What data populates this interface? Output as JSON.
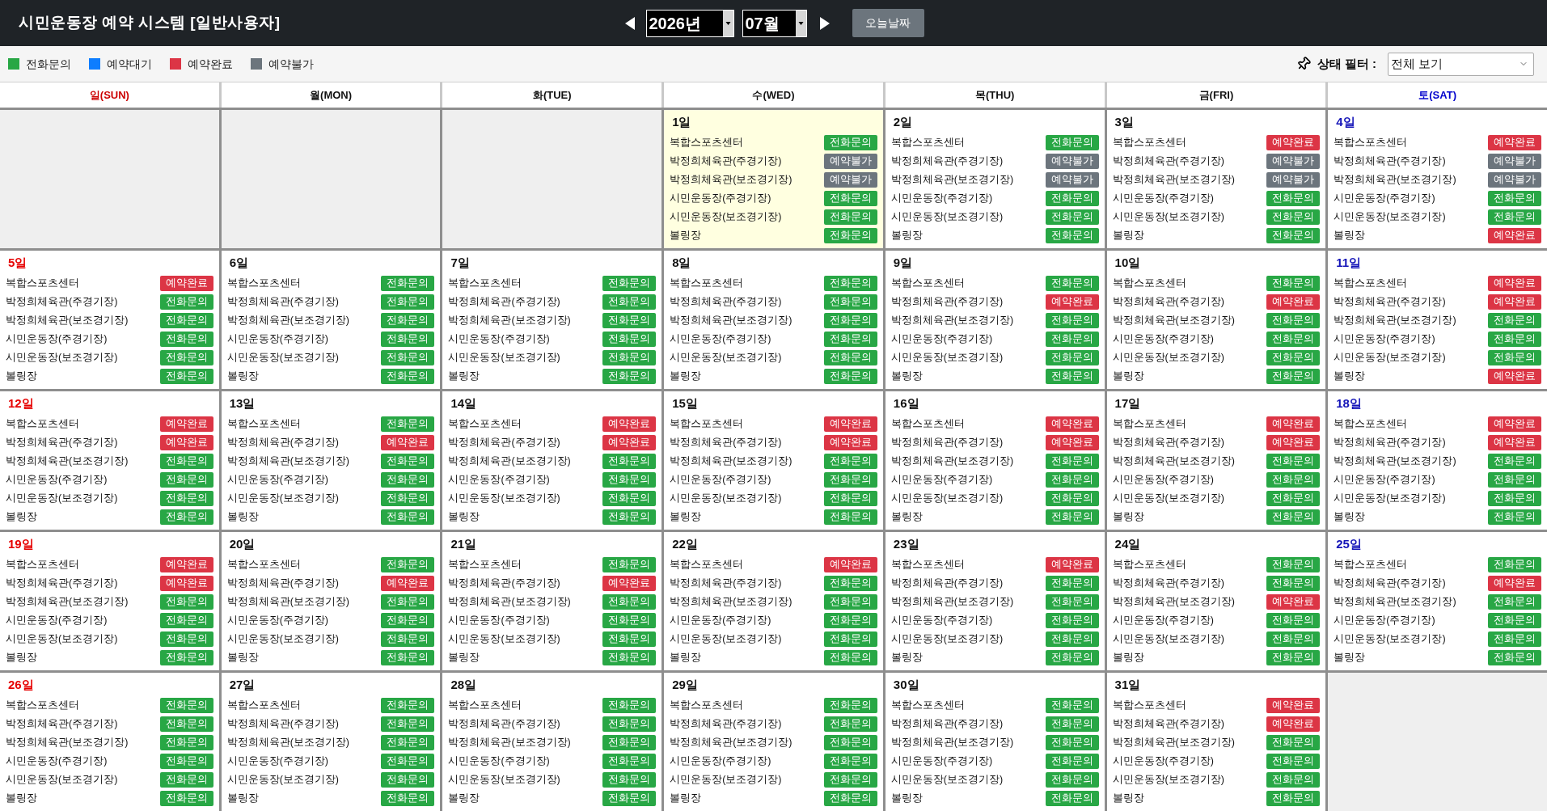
{
  "header": {
    "title": "시민운동장 예약 시스템 [일반사용자]",
    "year": "2026년",
    "month": "07월",
    "today_button": "오늘날짜"
  },
  "legend": [
    {
      "label": "전화문의",
      "kind": "phone",
      "color": "#28a745"
    },
    {
      "label": "예약대기",
      "kind": "waiting",
      "color": "#0d7dff"
    },
    {
      "label": "예약완료",
      "kind": "booked",
      "color": "#dc3545"
    },
    {
      "label": "예약불가",
      "kind": "unavailable",
      "color": "#6c757d"
    }
  ],
  "filter": {
    "label": "상태 필터 :",
    "value": "전체 보기"
  },
  "calendar": {
    "weekdays": [
      {
        "label": "일(SUN)",
        "kind": "sunday"
      },
      {
        "label": "월(MON)",
        "kind": "weekday"
      },
      {
        "label": "화(TUE)",
        "kind": "weekday"
      },
      {
        "label": "수(WED)",
        "kind": "weekday"
      },
      {
        "label": "목(THU)",
        "kind": "weekday"
      },
      {
        "label": "금(FRI)",
        "kind": "weekday"
      },
      {
        "label": "토(SAT)",
        "kind": "saturday"
      }
    ],
    "weeks": [
      {
        "cells": [
          {
            "kind": "blank"
          },
          {
            "kind": "blank"
          },
          {
            "kind": "blank"
          },
          {
            "kind": "day",
            "date": "1일",
            "today": true,
            "slots": [
              {
                "facility": "복합스포츠센터",
                "status": "전화문의",
                "kind": "phone"
              },
              {
                "facility": "박정희체육관(주경기장)",
                "status": "예약불가",
                "kind": "unavailable"
              },
              {
                "facility": "박정희체육관(보조경기장)",
                "status": "예약불가",
                "kind": "unavailable"
              },
              {
                "facility": "시민운동장(주경기장)",
                "status": "전화문의",
                "kind": "phone"
              },
              {
                "facility": "시민운동장(보조경기장)",
                "status": "전화문의",
                "kind": "phone"
              },
              {
                "facility": "볼링장",
                "status": "전화문의",
                "kind": "phone"
              }
            ]
          },
          {
            "kind": "day",
            "date": "2일",
            "today": false,
            "slots": [
              {
                "facility": "복합스포츠센터",
                "status": "전화문의",
                "kind": "phone"
              },
              {
                "facility": "박정희체육관(주경기장)",
                "status": "예약불가",
                "kind": "unavailable"
              },
              {
                "facility": "박정희체육관(보조경기장)",
                "status": "예약불가",
                "kind": "unavailable"
              },
              {
                "facility": "시민운동장(주경기장)",
                "status": "전화문의",
                "kind": "phone"
              },
              {
                "facility": "시민운동장(보조경기장)",
                "status": "전화문의",
                "kind": "phone"
              },
              {
                "facility": "볼링장",
                "status": "전화문의",
                "kind": "phone"
              }
            ]
          },
          {
            "kind": "day",
            "date": "3일",
            "today": false,
            "slots": [
              {
                "facility": "복합스포츠센터",
                "status": "예약완료",
                "kind": "booked"
              },
              {
                "facility": "박정희체육관(주경기장)",
                "status": "예약불가",
                "kind": "unavailable"
              },
              {
                "facility": "박정희체육관(보조경기장)",
                "status": "예약불가",
                "kind": "unavailable"
              },
              {
                "facility": "시민운동장(주경기장)",
                "status": "전화문의",
                "kind": "phone"
              },
              {
                "facility": "시민운동장(보조경기장)",
                "status": "전화문의",
                "kind": "phone"
              },
              {
                "facility": "볼링장",
                "status": "전화문의",
                "kind": "phone"
              }
            ]
          },
          {
            "kind": "day",
            "date": "4일",
            "today": false,
            "slots": [
              {
                "facility": "복합스포츠센터",
                "status": "예약완료",
                "kind": "booked"
              },
              {
                "facility": "박정희체육관(주경기장)",
                "status": "예약불가",
                "kind": "unavailable"
              },
              {
                "facility": "박정희체육관(보조경기장)",
                "status": "예약불가",
                "kind": "unavailable"
              },
              {
                "facility": "시민운동장(주경기장)",
                "status": "전화문의",
                "kind": "phone"
              },
              {
                "facility": "시민운동장(보조경기장)",
                "status": "전화문의",
                "kind": "phone"
              },
              {
                "facility": "볼링장",
                "status": "예약완료",
                "kind": "booked"
              }
            ]
          }
        ]
      },
      {
        "cells": [
          {
            "kind": "day",
            "date": "5일",
            "today": false,
            "slots": [
              {
                "facility": "복합스포츠센터",
                "status": "예약완료",
                "kind": "booked"
              },
              {
                "facility": "박정희체육관(주경기장)",
                "status": "전화문의",
                "kind": "phone"
              },
              {
                "facility": "박정희체육관(보조경기장)",
                "status": "전화문의",
                "kind": "phone"
              },
              {
                "facility": "시민운동장(주경기장)",
                "status": "전화문의",
                "kind": "phone"
              },
              {
                "facility": "시민운동장(보조경기장)",
                "status": "전화문의",
                "kind": "phone"
              },
              {
                "facility": "볼링장",
                "status": "전화문의",
                "kind": "phone"
              }
            ]
          },
          {
            "kind": "day",
            "date": "6일",
            "today": false,
            "slots": [
              {
                "facility": "복합스포츠센터",
                "status": "전화문의",
                "kind": "phone"
              },
              {
                "facility": "박정희체육관(주경기장)",
                "status": "전화문의",
                "kind": "phone"
              },
              {
                "facility": "박정희체육관(보조경기장)",
                "status": "전화문의",
                "kind": "phone"
              },
              {
                "facility": "시민운동장(주경기장)",
                "status": "전화문의",
                "kind": "phone"
              },
              {
                "facility": "시민운동장(보조경기장)",
                "status": "전화문의",
                "kind": "phone"
              },
              {
                "facility": "볼링장",
                "status": "전화문의",
                "kind": "phone"
              }
            ]
          },
          {
            "kind": "day",
            "date": "7일",
            "today": false,
            "slots": [
              {
                "facility": "복합스포츠센터",
                "status": "전화문의",
                "kind": "phone"
              },
              {
                "facility": "박정희체육관(주경기장)",
                "status": "전화문의",
                "kind": "phone"
              },
              {
                "facility": "박정희체육관(보조경기장)",
                "status": "전화문의",
                "kind": "phone"
              },
              {
                "facility": "시민운동장(주경기장)",
                "status": "전화문의",
                "kind": "phone"
              },
              {
                "facility": "시민운동장(보조경기장)",
                "status": "전화문의",
                "kind": "phone"
              },
              {
                "facility": "볼링장",
                "status": "전화문의",
                "kind": "phone"
              }
            ]
          },
          {
            "kind": "day",
            "date": "8일",
            "today": false,
            "slots": [
              {
                "facility": "복합스포츠센터",
                "status": "전화문의",
                "kind": "phone"
              },
              {
                "facility": "박정희체육관(주경기장)",
                "status": "전화문의",
                "kind": "phone"
              },
              {
                "facility": "박정희체육관(보조경기장)",
                "status": "전화문의",
                "kind": "phone"
              },
              {
                "facility": "시민운동장(주경기장)",
                "status": "전화문의",
                "kind": "phone"
              },
              {
                "facility": "시민운동장(보조경기장)",
                "status": "전화문의",
                "kind": "phone"
              },
              {
                "facility": "볼링장",
                "status": "전화문의",
                "kind": "phone"
              }
            ]
          },
          {
            "kind": "day",
            "date": "9일",
            "today": false,
            "slots": [
              {
                "facility": "복합스포츠센터",
                "status": "전화문의",
                "kind": "phone"
              },
              {
                "facility": "박정희체육관(주경기장)",
                "status": "예약완료",
                "kind": "booked"
              },
              {
                "facility": "박정희체육관(보조경기장)",
                "status": "전화문의",
                "kind": "phone"
              },
              {
                "facility": "시민운동장(주경기장)",
                "status": "전화문의",
                "kind": "phone"
              },
              {
                "facility": "시민운동장(보조경기장)",
                "status": "전화문의",
                "kind": "phone"
              },
              {
                "facility": "볼링장",
                "status": "전화문의",
                "kind": "phone"
              }
            ]
          },
          {
            "kind": "day",
            "date": "10일",
            "today": false,
            "slots": [
              {
                "facility": "복합스포츠센터",
                "status": "전화문의",
                "kind": "phone"
              },
              {
                "facility": "박정희체육관(주경기장)",
                "status": "예약완료",
                "kind": "booked"
              },
              {
                "facility": "박정희체육관(보조경기장)",
                "status": "전화문의",
                "kind": "phone"
              },
              {
                "facility": "시민운동장(주경기장)",
                "status": "전화문의",
                "kind": "phone"
              },
              {
                "facility": "시민운동장(보조경기장)",
                "status": "전화문의",
                "kind": "phone"
              },
              {
                "facility": "볼링장",
                "status": "전화문의",
                "kind": "phone"
              }
            ]
          },
          {
            "kind": "day",
            "date": "11일",
            "today": false,
            "slots": [
              {
                "facility": "복합스포츠센터",
                "status": "예약완료",
                "kind": "booked"
              },
              {
                "facility": "박정희체육관(주경기장)",
                "status": "예약완료",
                "kind": "booked"
              },
              {
                "facility": "박정희체육관(보조경기장)",
                "status": "전화문의",
                "kind": "phone"
              },
              {
                "facility": "시민운동장(주경기장)",
                "status": "전화문의",
                "kind": "phone"
              },
              {
                "facility": "시민운동장(보조경기장)",
                "status": "전화문의",
                "kind": "phone"
              },
              {
                "facility": "볼링장",
                "status": "예약완료",
                "kind": "booked"
              }
            ]
          }
        ]
      },
      {
        "cells": [
          {
            "kind": "day",
            "date": "12일",
            "today": false,
            "slots": [
              {
                "facility": "복합스포츠센터",
                "status": "예약완료",
                "kind": "booked"
              },
              {
                "facility": "박정희체육관(주경기장)",
                "status": "예약완료",
                "kind": "booked"
              },
              {
                "facility": "박정희체육관(보조경기장)",
                "status": "전화문의",
                "kind": "phone"
              },
              {
                "facility": "시민운동장(주경기장)",
                "status": "전화문의",
                "kind": "phone"
              },
              {
                "facility": "시민운동장(보조경기장)",
                "status": "전화문의",
                "kind": "phone"
              },
              {
                "facility": "볼링장",
                "status": "전화문의",
                "kind": "phone"
              }
            ]
          },
          {
            "kind": "day",
            "date": "13일",
            "today": false,
            "slots": [
              {
                "facility": "복합스포츠센터",
                "status": "전화문의",
                "kind": "phone"
              },
              {
                "facility": "박정희체육관(주경기장)",
                "status": "예약완료",
                "kind": "booked"
              },
              {
                "facility": "박정희체육관(보조경기장)",
                "status": "전화문의",
                "kind": "phone"
              },
              {
                "facility": "시민운동장(주경기장)",
                "status": "전화문의",
                "kind": "phone"
              },
              {
                "facility": "시민운동장(보조경기장)",
                "status": "전화문의",
                "kind": "phone"
              },
              {
                "facility": "볼링장",
                "status": "전화문의",
                "kind": "phone"
              }
            ]
          },
          {
            "kind": "day",
            "date": "14일",
            "today": false,
            "slots": [
              {
                "facility": "복합스포츠센터",
                "status": "예약완료",
                "kind": "booked"
              },
              {
                "facility": "박정희체육관(주경기장)",
                "status": "예약완료",
                "kind": "booked"
              },
              {
                "facility": "박정희체육관(보조경기장)",
                "status": "전화문의",
                "kind": "phone"
              },
              {
                "facility": "시민운동장(주경기장)",
                "status": "전화문의",
                "kind": "phone"
              },
              {
                "facility": "시민운동장(보조경기장)",
                "status": "전화문의",
                "kind": "phone"
              },
              {
                "facility": "볼링장",
                "status": "전화문의",
                "kind": "phone"
              }
            ]
          },
          {
            "kind": "day",
            "date": "15일",
            "today": false,
            "slots": [
              {
                "facility": "복합스포츠센터",
                "status": "예약완료",
                "kind": "booked"
              },
              {
                "facility": "박정희체육관(주경기장)",
                "status": "예약완료",
                "kind": "booked"
              },
              {
                "facility": "박정희체육관(보조경기장)",
                "status": "전화문의",
                "kind": "phone"
              },
              {
                "facility": "시민운동장(주경기장)",
                "status": "전화문의",
                "kind": "phone"
              },
              {
                "facility": "시민운동장(보조경기장)",
                "status": "전화문의",
                "kind": "phone"
              },
              {
                "facility": "볼링장",
                "status": "전화문의",
                "kind": "phone"
              }
            ]
          },
          {
            "kind": "day",
            "date": "16일",
            "today": false,
            "slots": [
              {
                "facility": "복합스포츠센터",
                "status": "예약완료",
                "kind": "booked"
              },
              {
                "facility": "박정희체육관(주경기장)",
                "status": "예약완료",
                "kind": "booked"
              },
              {
                "facility": "박정희체육관(보조경기장)",
                "status": "전화문의",
                "kind": "phone"
              },
              {
                "facility": "시민운동장(주경기장)",
                "status": "전화문의",
                "kind": "phone"
              },
              {
                "facility": "시민운동장(보조경기장)",
                "status": "전화문의",
                "kind": "phone"
              },
              {
                "facility": "볼링장",
                "status": "전화문의",
                "kind": "phone"
              }
            ]
          },
          {
            "kind": "day",
            "date": "17일",
            "today": false,
            "slots": [
              {
                "facility": "복합스포츠센터",
                "status": "예약완료",
                "kind": "booked"
              },
              {
                "facility": "박정희체육관(주경기장)",
                "status": "예약완료",
                "kind": "booked"
              },
              {
                "facility": "박정희체육관(보조경기장)",
                "status": "전화문의",
                "kind": "phone"
              },
              {
                "facility": "시민운동장(주경기장)",
                "status": "전화문의",
                "kind": "phone"
              },
              {
                "facility": "시민운동장(보조경기장)",
                "status": "전화문의",
                "kind": "phone"
              },
              {
                "facility": "볼링장",
                "status": "전화문의",
                "kind": "phone"
              }
            ]
          },
          {
            "kind": "day",
            "date": "18일",
            "today": false,
            "slots": [
              {
                "facility": "복합스포츠센터",
                "status": "예약완료",
                "kind": "booked"
              },
              {
                "facility": "박정희체육관(주경기장)",
                "status": "예약완료",
                "kind": "booked"
              },
              {
                "facility": "박정희체육관(보조경기장)",
                "status": "전화문의",
                "kind": "phone"
              },
              {
                "facility": "시민운동장(주경기장)",
                "status": "전화문의",
                "kind": "phone"
              },
              {
                "facility": "시민운동장(보조경기장)",
                "status": "전화문의",
                "kind": "phone"
              },
              {
                "facility": "볼링장",
                "status": "전화문의",
                "kind": "phone"
              }
            ]
          }
        ]
      },
      {
        "cells": [
          {
            "kind": "day",
            "date": "19일",
            "today": false,
            "slots": [
              {
                "facility": "복합스포츠센터",
                "status": "예약완료",
                "kind": "booked"
              },
              {
                "facility": "박정희체육관(주경기장)",
                "status": "예약완료",
                "kind": "booked"
              },
              {
                "facility": "박정희체육관(보조경기장)",
                "status": "전화문의",
                "kind": "phone"
              },
              {
                "facility": "시민운동장(주경기장)",
                "status": "전화문의",
                "kind": "phone"
              },
              {
                "facility": "시민운동장(보조경기장)",
                "status": "전화문의",
                "kind": "phone"
              },
              {
                "facility": "볼링장",
                "status": "전화문의",
                "kind": "phone"
              }
            ]
          },
          {
            "kind": "day",
            "date": "20일",
            "today": false,
            "slots": [
              {
                "facility": "복합스포츠센터",
                "status": "전화문의",
                "kind": "phone"
              },
              {
                "facility": "박정희체육관(주경기장)",
                "status": "예약완료",
                "kind": "booked"
              },
              {
                "facility": "박정희체육관(보조경기장)",
                "status": "전화문의",
                "kind": "phone"
              },
              {
                "facility": "시민운동장(주경기장)",
                "status": "전화문의",
                "kind": "phone"
              },
              {
                "facility": "시민운동장(보조경기장)",
                "status": "전화문의",
                "kind": "phone"
              },
              {
                "facility": "볼링장",
                "status": "전화문의",
                "kind": "phone"
              }
            ]
          },
          {
            "kind": "day",
            "date": "21일",
            "today": false,
            "slots": [
              {
                "facility": "복합스포츠센터",
                "status": "전화문의",
                "kind": "phone"
              },
              {
                "facility": "박정희체육관(주경기장)",
                "status": "예약완료",
                "kind": "booked"
              },
              {
                "facility": "박정희체육관(보조경기장)",
                "status": "전화문의",
                "kind": "phone"
              },
              {
                "facility": "시민운동장(주경기장)",
                "status": "전화문의",
                "kind": "phone"
              },
              {
                "facility": "시민운동장(보조경기장)",
                "status": "전화문의",
                "kind": "phone"
              },
              {
                "facility": "볼링장",
                "status": "전화문의",
                "kind": "phone"
              }
            ]
          },
          {
            "kind": "day",
            "date": "22일",
            "today": false,
            "slots": [
              {
                "facility": "복합스포츠센터",
                "status": "예약완료",
                "kind": "booked"
              },
              {
                "facility": "박정희체육관(주경기장)",
                "status": "전화문의",
                "kind": "phone"
              },
              {
                "facility": "박정희체육관(보조경기장)",
                "status": "전화문의",
                "kind": "phone"
              },
              {
                "facility": "시민운동장(주경기장)",
                "status": "전화문의",
                "kind": "phone"
              },
              {
                "facility": "시민운동장(보조경기장)",
                "status": "전화문의",
                "kind": "phone"
              },
              {
                "facility": "볼링장",
                "status": "전화문의",
                "kind": "phone"
              }
            ]
          },
          {
            "kind": "day",
            "date": "23일",
            "today": false,
            "slots": [
              {
                "facility": "복합스포츠센터",
                "status": "예약완료",
                "kind": "booked"
              },
              {
                "facility": "박정희체육관(주경기장)",
                "status": "전화문의",
                "kind": "phone"
              },
              {
                "facility": "박정희체육관(보조경기장)",
                "status": "전화문의",
                "kind": "phone"
              },
              {
                "facility": "시민운동장(주경기장)",
                "status": "전화문의",
                "kind": "phone"
              },
              {
                "facility": "시민운동장(보조경기장)",
                "status": "전화문의",
                "kind": "phone"
              },
              {
                "facility": "볼링장",
                "status": "전화문의",
                "kind": "phone"
              }
            ]
          },
          {
            "kind": "day",
            "date": "24일",
            "today": false,
            "slots": [
              {
                "facility": "복합스포츠센터",
                "status": "전화문의",
                "kind": "phone"
              },
              {
                "facility": "박정희체육관(주경기장)",
                "status": "전화문의",
                "kind": "phone"
              },
              {
                "facility": "박정희체육관(보조경기장)",
                "status": "예약완료",
                "kind": "booked"
              },
              {
                "facility": "시민운동장(주경기장)",
                "status": "전화문의",
                "kind": "phone"
              },
              {
                "facility": "시민운동장(보조경기장)",
                "status": "전화문의",
                "kind": "phone"
              },
              {
                "facility": "볼링장",
                "status": "전화문의",
                "kind": "phone"
              }
            ]
          },
          {
            "kind": "day",
            "date": "25일",
            "today": false,
            "slots": [
              {
                "facility": "복합스포츠센터",
                "status": "전화문의",
                "kind": "phone"
              },
              {
                "facility": "박정희체육관(주경기장)",
                "status": "예약완료",
                "kind": "booked"
              },
              {
                "facility": "박정희체육관(보조경기장)",
                "status": "전화문의",
                "kind": "phone"
              },
              {
                "facility": "시민운동장(주경기장)",
                "status": "전화문의",
                "kind": "phone"
              },
              {
                "facility": "시민운동장(보조경기장)",
                "status": "전화문의",
                "kind": "phone"
              },
              {
                "facility": "볼링장",
                "status": "전화문의",
                "kind": "phone"
              }
            ]
          }
        ]
      },
      {
        "cells": [
          {
            "kind": "day",
            "date": "26일",
            "today": false,
            "slots": [
              {
                "facility": "복합스포츠센터",
                "status": "전화문의",
                "kind": "phone"
              },
              {
                "facility": "박정희체육관(주경기장)",
                "status": "전화문의",
                "kind": "phone"
              },
              {
                "facility": "박정희체육관(보조경기장)",
                "status": "전화문의",
                "kind": "phone"
              },
              {
                "facility": "시민운동장(주경기장)",
                "status": "전화문의",
                "kind": "phone"
              },
              {
                "facility": "시민운동장(보조경기장)",
                "status": "전화문의",
                "kind": "phone"
              },
              {
                "facility": "볼링장",
                "status": "전화문의",
                "kind": "phone"
              }
            ]
          },
          {
            "kind": "day",
            "date": "27일",
            "today": false,
            "slots": [
              {
                "facility": "복합스포츠센터",
                "status": "전화문의",
                "kind": "phone"
              },
              {
                "facility": "박정희체육관(주경기장)",
                "status": "전화문의",
                "kind": "phone"
              },
              {
                "facility": "박정희체육관(보조경기장)",
                "status": "전화문의",
                "kind": "phone"
              },
              {
                "facility": "시민운동장(주경기장)",
                "status": "전화문의",
                "kind": "phone"
              },
              {
                "facility": "시민운동장(보조경기장)",
                "status": "전화문의",
                "kind": "phone"
              },
              {
                "facility": "볼링장",
                "status": "전화문의",
                "kind": "phone"
              }
            ]
          },
          {
            "kind": "day",
            "date": "28일",
            "today": false,
            "slots": [
              {
                "facility": "복합스포츠센터",
                "status": "전화문의",
                "kind": "phone"
              },
              {
                "facility": "박정희체육관(주경기장)",
                "status": "전화문의",
                "kind": "phone"
              },
              {
                "facility": "박정희체육관(보조경기장)",
                "status": "전화문의",
                "kind": "phone"
              },
              {
                "facility": "시민운동장(주경기장)",
                "status": "전화문의",
                "kind": "phone"
              },
              {
                "facility": "시민운동장(보조경기장)",
                "status": "전화문의",
                "kind": "phone"
              },
              {
                "facility": "볼링장",
                "status": "전화문의",
                "kind": "phone"
              }
            ]
          },
          {
            "kind": "day",
            "date": "29일",
            "today": false,
            "slots": [
              {
                "facility": "복합스포츠센터",
                "status": "전화문의",
                "kind": "phone"
              },
              {
                "facility": "박정희체육관(주경기장)",
                "status": "전화문의",
                "kind": "phone"
              },
              {
                "facility": "박정희체육관(보조경기장)",
                "status": "전화문의",
                "kind": "phone"
              },
              {
                "facility": "시민운동장(주경기장)",
                "status": "전화문의",
                "kind": "phone"
              },
              {
                "facility": "시민운동장(보조경기장)",
                "status": "전화문의",
                "kind": "phone"
              },
              {
                "facility": "볼링장",
                "status": "전화문의",
                "kind": "phone"
              }
            ]
          },
          {
            "kind": "day",
            "date": "30일",
            "today": false,
            "slots": [
              {
                "facility": "복합스포츠센터",
                "status": "전화문의",
                "kind": "phone"
              },
              {
                "facility": "박정희체육관(주경기장)",
                "status": "전화문의",
                "kind": "phone"
              },
              {
                "facility": "박정희체육관(보조경기장)",
                "status": "전화문의",
                "kind": "phone"
              },
              {
                "facility": "시민운동장(주경기장)",
                "status": "전화문의",
                "kind": "phone"
              },
              {
                "facility": "시민운동장(보조경기장)",
                "status": "전화문의",
                "kind": "phone"
              },
              {
                "facility": "볼링장",
                "status": "전화문의",
                "kind": "phone"
              }
            ]
          },
          {
            "kind": "day",
            "date": "31일",
            "today": false,
            "slots": [
              {
                "facility": "복합스포츠센터",
                "status": "예약완료",
                "kind": "booked"
              },
              {
                "facility": "박정희체육관(주경기장)",
                "status": "예약완료",
                "kind": "booked"
              },
              {
                "facility": "박정희체육관(보조경기장)",
                "status": "전화문의",
                "kind": "phone"
              },
              {
                "facility": "시민운동장(주경기장)",
                "status": "전화문의",
                "kind": "phone"
              },
              {
                "facility": "시민운동장(보조경기장)",
                "status": "전화문의",
                "kind": "phone"
              },
              {
                "facility": "볼링장",
                "status": "전화문의",
                "kind": "phone"
              }
            ]
          },
          {
            "kind": "blank"
          }
        ]
      }
    ]
  }
}
